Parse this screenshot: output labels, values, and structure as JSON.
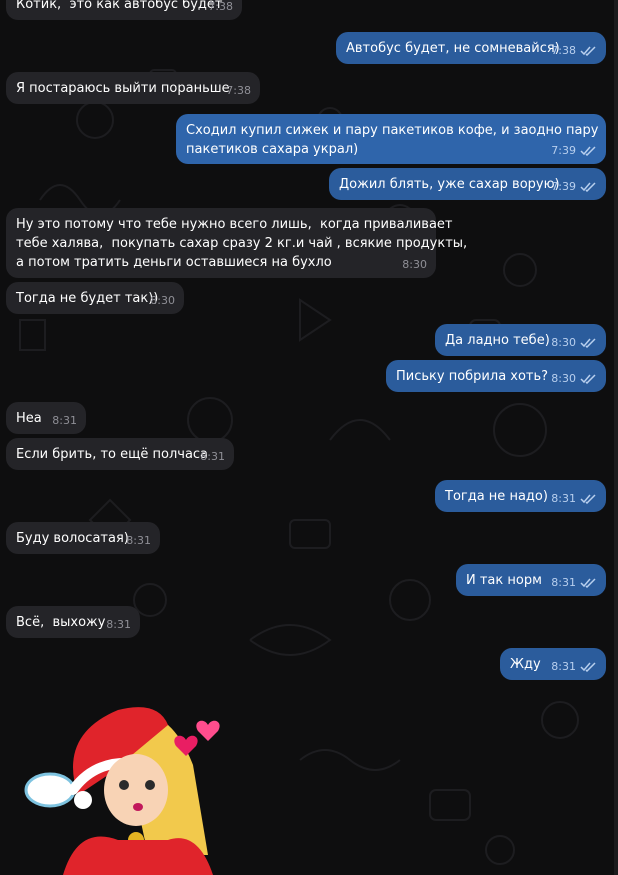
{
  "chat": {
    "messages": [
      {
        "direction": "in",
        "text": "Котик,  это как автобус будет",
        "time": "7:38"
      },
      {
        "direction": "out",
        "text": "Автобус будет, не сомневайся)",
        "time": "7:38",
        "status": "read"
      },
      {
        "direction": "in",
        "text": "Я постараюсь выйти пораньше",
        "time": "7:38"
      },
      {
        "direction": "out",
        "text": "Сходил купил сижек и пару пакетиков кофе, и заодно пару\nпакетиков сахара украл)",
        "time": "7:39",
        "status": "read"
      },
      {
        "direction": "out",
        "text": "Дожил блять, уже сахар ворую)",
        "time": "7:39",
        "status": "read"
      },
      {
        "direction": "in",
        "text": "Ну это потому что тебе нужно всего лишь,  когда привaливает\nтебе халява,  покупать сахар сразу 2 кг.и чай , всякие продукты,\nа потом тратить деньги оставшиеся на бухло",
        "time": "8:30"
      },
      {
        "direction": "in",
        "text": "Тогда не будет так))",
        "time": "8:30"
      },
      {
        "direction": "out",
        "text": "Да ладно тебе)",
        "time": "8:30",
        "status": "read"
      },
      {
        "direction": "out",
        "text": "Письку побрила хоть?",
        "time": "8:30",
        "status": "read"
      },
      {
        "direction": "in",
        "text": "Неа",
        "time": "8:31"
      },
      {
        "direction": "in",
        "text": "Если брить, то ещё полчаса",
        "time": "8:31"
      },
      {
        "direction": "out",
        "text": "Тогда не надо)",
        "time": "8:31",
        "status": "read"
      },
      {
        "direction": "in",
        "text": "Буду волосатая)",
        "time": "8:31"
      },
      {
        "direction": "out",
        "text": "И так норм",
        "time": "8:31",
        "status": "read"
      },
      {
        "direction": "in",
        "text": "Всё,  выхожу",
        "time": "8:31"
      },
      {
        "direction": "out",
        "text": "Жду",
        "time": "8:31",
        "status": "read"
      }
    ],
    "sticker": {
      "name": "girl-blowing-kiss-sticker"
    }
  },
  "colors": {
    "background": "#0e0e0f",
    "incoming_bubble": "#242428",
    "outgoing_bubble": "#2b5c9c",
    "read_ticks": "#b8cfee"
  }
}
